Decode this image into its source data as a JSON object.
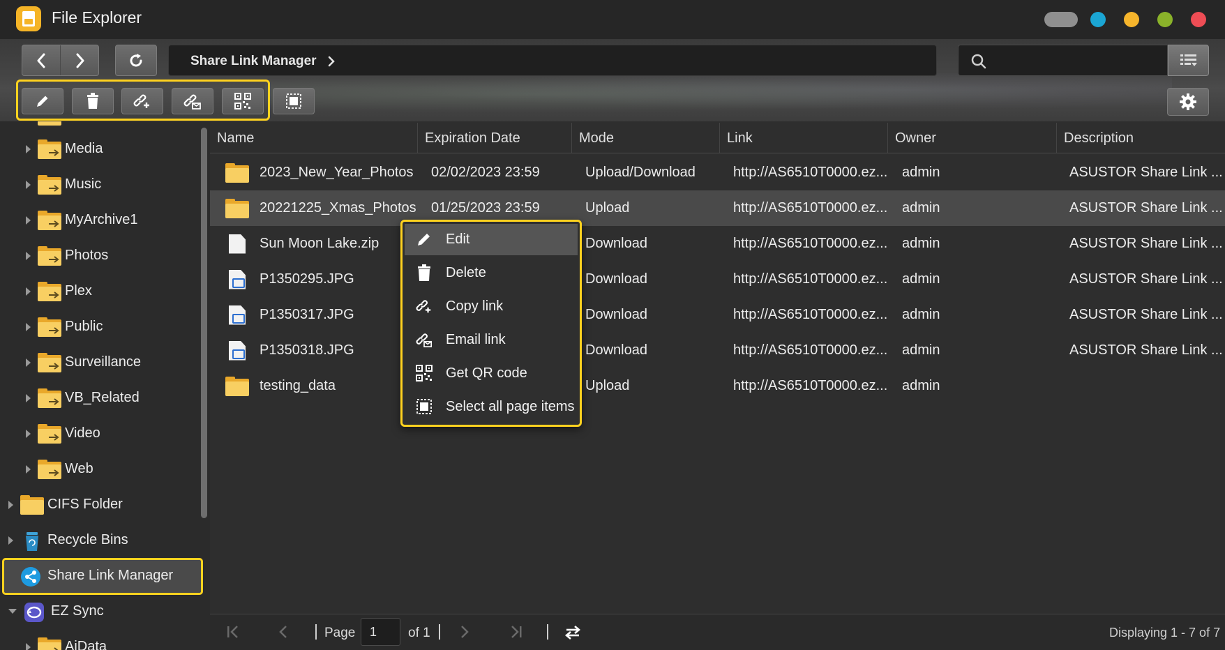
{
  "window": {
    "title": "File Explorer",
    "controls": [
      "toggle-pill",
      "blue-dot",
      "yellow-dot",
      "green-dot",
      "close-dot"
    ]
  },
  "toolbar": {
    "back_icon": "chevron-left-icon",
    "forward_icon": "chevron-right-icon",
    "refresh_icon": "refresh-icon",
    "breadcrumb": "Share Link Manager",
    "search_placeholder": "",
    "view_icon": "list-view-icon",
    "actions": [
      "edit-icon",
      "delete-icon",
      "copy-link-icon",
      "email-link-icon",
      "qr-code-icon",
      "select-all-icon"
    ],
    "settings_icon": "gear-icon"
  },
  "sidebar": {
    "items": [
      {
        "label": "Media",
        "type": "share-folder"
      },
      {
        "label": "Music",
        "type": "share-folder"
      },
      {
        "label": "MyArchive1",
        "type": "share-folder"
      },
      {
        "label": "Photos",
        "type": "share-folder"
      },
      {
        "label": "Plex",
        "type": "share-folder"
      },
      {
        "label": "Public",
        "type": "share-folder"
      },
      {
        "label": "Surveillance",
        "type": "share-folder"
      },
      {
        "label": "VB_Related",
        "type": "share-folder"
      },
      {
        "label": "Video",
        "type": "share-folder"
      },
      {
        "label": "Web",
        "type": "share-folder"
      },
      {
        "label": "CIFS Folder",
        "type": "folder"
      },
      {
        "label": "Recycle Bins",
        "type": "recycle"
      },
      {
        "label": "Share Link Manager",
        "type": "share-link",
        "selected": true
      },
      {
        "label": "EZ Sync",
        "type": "ezsync"
      },
      {
        "label": "AiData",
        "type": "share-folder"
      }
    ]
  },
  "table": {
    "columns": [
      "Name",
      "Expiration Date",
      "Mode",
      "Link",
      "Owner",
      "Description"
    ],
    "rows": [
      {
        "name": "2023_New_Year_Photos",
        "icon": "folder-icon",
        "expiration": "02/02/2023 23:59",
        "mode": "Upload/Download",
        "link": "http://AS6510T0000.ez...",
        "owner": "admin",
        "description": "ASUSTOR Share Link ..."
      },
      {
        "name": "20221225_Xmas_Photos",
        "icon": "folder-icon",
        "expiration": "01/25/2023 23:59",
        "mode": "Upload",
        "link": "http://AS6510T0000.ez...",
        "owner": "admin",
        "description": "ASUSTOR Share Link ...",
        "selected": true
      },
      {
        "name": "Sun Moon Lake.zip",
        "icon": "file-icon",
        "expiration": "",
        "mode": "Download",
        "link": "http://AS6510T0000.ez...",
        "owner": "admin",
        "description": "ASUSTOR Share Link ..."
      },
      {
        "name": "P1350295.JPG",
        "icon": "image-file-icon",
        "expiration": "",
        "mode": "Download",
        "link": "http://AS6510T0000.ez...",
        "owner": "admin",
        "description": "ASUSTOR Share Link ..."
      },
      {
        "name": "P1350317.JPG",
        "icon": "image-file-icon",
        "expiration": "",
        "mode": "Download",
        "link": "http://AS6510T0000.ez...",
        "owner": "admin",
        "description": "ASUSTOR Share Link ..."
      },
      {
        "name": "P1350318.JPG",
        "icon": "image-file-icon",
        "expiration": "",
        "mode": "Download",
        "link": "http://AS6510T0000.ez...",
        "owner": "admin",
        "description": "ASUSTOR Share Link ..."
      },
      {
        "name": "testing_data",
        "icon": "folder-icon",
        "expiration": "",
        "mode": "Upload",
        "link": "http://AS6510T0000.ez...",
        "owner": "admin",
        "description": ""
      }
    ]
  },
  "context_menu": {
    "items": [
      {
        "label": "Edit",
        "icon": "edit-icon",
        "hover": true
      },
      {
        "label": "Delete",
        "icon": "delete-icon"
      },
      {
        "label": "Copy link",
        "icon": "copy-link-icon"
      },
      {
        "label": "Email link",
        "icon": "email-link-icon"
      },
      {
        "label": "Get QR code",
        "icon": "qr-code-icon"
      },
      {
        "label": "Select all page items",
        "icon": "select-all-icon"
      }
    ]
  },
  "pager": {
    "page_label": "Page",
    "page_value": "1",
    "of_label": "of 1",
    "display_text": "Displaying 1 - 7 of 7"
  },
  "colors": {
    "highlight": "#ffd21f",
    "folder": "#f8cf62",
    "selected_row": "#4a4a4a"
  }
}
